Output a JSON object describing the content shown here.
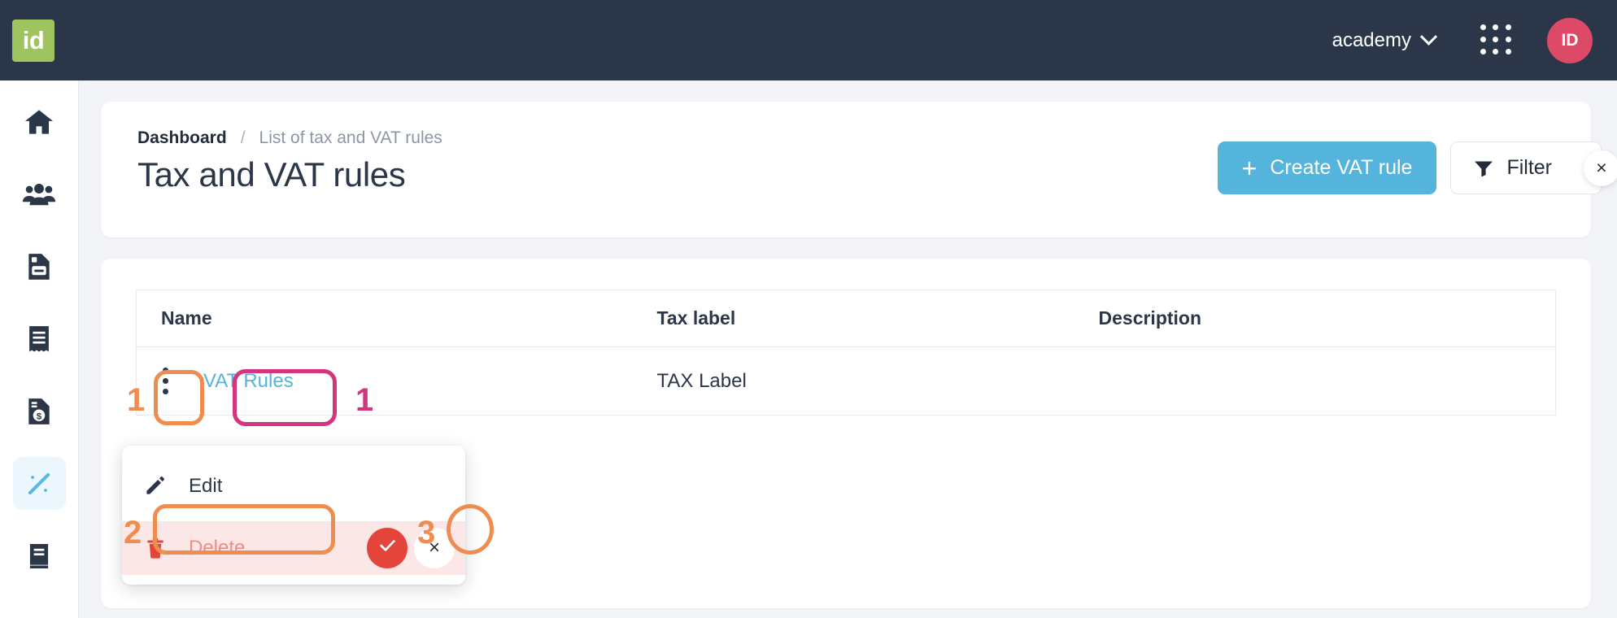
{
  "topbar": {
    "logo_text": "id",
    "org_name": "academy",
    "chevron_icon": "chevron-down-icon",
    "apps_icon": "apps-grid-icon",
    "avatar_initials": "ID"
  },
  "sidebar": {
    "items": [
      {
        "icon": "home-icon",
        "label": "Home",
        "active": false
      },
      {
        "icon": "users-icon",
        "label": "Customers",
        "active": false
      },
      {
        "icon": "document-icon",
        "label": "Documents",
        "active": false
      },
      {
        "icon": "receipt-icon",
        "label": "Receipts",
        "active": false
      },
      {
        "icon": "invoice-dollar-icon",
        "label": "Invoices",
        "active": false
      },
      {
        "icon": "percent-icon",
        "label": "Tax and VAT",
        "active": true
      },
      {
        "icon": "book-icon",
        "label": "Ledger",
        "active": false
      }
    ]
  },
  "header": {
    "breadcrumb": {
      "root": "Dashboard",
      "separator": "/",
      "current": "List of tax and VAT rules"
    },
    "title": "Tax and VAT rules",
    "create_button": {
      "label": "Create VAT rule",
      "icon": "plus-icon"
    },
    "filter_button": {
      "label": "Filter",
      "icon": "funnel-icon"
    },
    "filter_clear": {
      "label": "×",
      "icon": "close-icon"
    }
  },
  "table": {
    "columns": [
      "Name",
      "Tax label",
      "Description"
    ],
    "rows": [
      {
        "name": "VAT Rules",
        "tax_label": "TAX Label",
        "description": ""
      }
    ],
    "row_menu_icon": "kebab-menu-icon"
  },
  "menu": {
    "items": [
      {
        "label": "Edit",
        "icon": "pencil-icon"
      },
      {
        "label": "Delete",
        "icon": "trash-icon"
      }
    ],
    "confirm_yes": {
      "icon": "check-icon"
    },
    "confirm_no": {
      "label": "×",
      "icon": "close-icon"
    }
  },
  "annotations": [
    {
      "id": "a1",
      "number": "1",
      "color": "#ef8c4f",
      "target": "row-kebab-menu"
    },
    {
      "id": "a2",
      "number": "1",
      "color": "#d4357e",
      "target": "row-name-link"
    },
    {
      "id": "a3",
      "number": "2",
      "color": "#ef8c4f",
      "target": "menu-item-delete"
    },
    {
      "id": "a4",
      "number": "3",
      "color": "#ef8c4f",
      "target": "delete-confirm-yes"
    }
  ],
  "colors": {
    "topbar_bg": "#2b3648",
    "page_bg": "#f2f4f7",
    "accent_blue": "#55b4dc",
    "logo_green": "#9ec45f",
    "avatar_pink": "#dd4a68",
    "danger_red": "#e4453a",
    "danger_bg": "#fbe7e5",
    "annotation_orange": "#ef8c4f",
    "annotation_pink": "#d4357e"
  }
}
